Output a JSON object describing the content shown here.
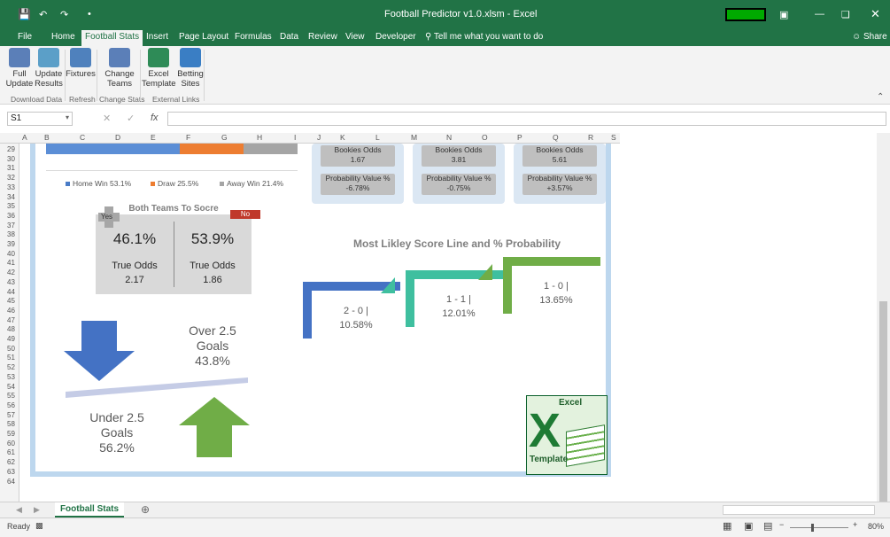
{
  "window": {
    "title": "Football Predictor v1.0.xlsm  -  Excel"
  },
  "ribbon_tabs": [
    "File",
    "Home",
    "Football Stats",
    "Insert",
    "Page Layout",
    "Formulas",
    "Data",
    "Review",
    "View",
    "Developer"
  ],
  "active_tab": "Football Stats",
  "tell_me": "Tell me what you want to do",
  "share": "Share",
  "ribbon": {
    "buttons": [
      {
        "l1": "Full",
        "l2": "Update"
      },
      {
        "l1": "Update",
        "l2": "Results"
      },
      {
        "l1": "Fixtures",
        "l2": ""
      },
      {
        "l1": "Change",
        "l2": "Teams"
      },
      {
        "l1": "Excel",
        "l2": "Template"
      },
      {
        "l1": "Betting",
        "l2": "Sites"
      }
    ],
    "groups": [
      "Download Data",
      "Refresh",
      "Change Stats",
      "External Links"
    ]
  },
  "formula_bar": {
    "name_box": "S1",
    "fx": "fx",
    "formula": ""
  },
  "columns": [
    "A",
    "B",
    "C",
    "D",
    "E",
    "F",
    "G",
    "H",
    "I",
    "J",
    "K",
    "L",
    "M",
    "N",
    "O",
    "P",
    "Q",
    "R",
    "S"
  ],
  "rows": [
    "29",
    "30",
    "31",
    "32",
    "33",
    "34",
    "35",
    "36",
    "37",
    "38",
    "39",
    "40",
    "41",
    "42",
    "43",
    "44",
    "45",
    "46",
    "47",
    "48",
    "49",
    "50",
    "51",
    "52",
    "53",
    "54",
    "55",
    "56",
    "57",
    "58",
    "59",
    "60",
    "61",
    "62",
    "63",
    "64"
  ],
  "legend": [
    {
      "label": "Home Win 53.1%",
      "color": "#4a7cc7"
    },
    {
      "label": "Draw 25.5%",
      "color": "#ed7d31"
    },
    {
      "label": "Away Win 21.4%",
      "color": "#a5a5a5"
    }
  ],
  "outcome_bar": [
    {
      "name": "Home Win",
      "value": 53.1,
      "color": "#5b8ed6"
    },
    {
      "name": "Draw",
      "value": 25.5,
      "color": "#ed7d31"
    },
    {
      "name": "Away Win",
      "value": 21.4,
      "color": "#a5a5a5"
    }
  ],
  "odds_cards": [
    {
      "bookies_label": "Bookies Odds",
      "bookies": "1.67",
      "pv_label": "Probability Value %",
      "pv": "-6.78%"
    },
    {
      "bookies_label": "Bookies Odds",
      "bookies": "3.81",
      "pv_label": "Probability Value %",
      "pv": "-0.75%"
    },
    {
      "bookies_label": "Bookies Odds",
      "bookies": "5.61",
      "pv_label": "Probability Value %",
      "pv": "+3.57%"
    }
  ],
  "btts": {
    "title": "Both Teams To Socre",
    "yes": "Yes",
    "no": "No",
    "yes_pct": "46.1%",
    "no_pct": "53.9%",
    "odds_label": "True Odds",
    "yes_odds": "2.17",
    "no_odds": "1.86"
  },
  "goals": {
    "over_l1": "Over 2.5",
    "over_l2": "Goals",
    "over_pct": "43.8%",
    "under_l1": "Under 2.5",
    "under_l2": "Goals",
    "under_pct": "56.2%"
  },
  "score_title": "Most Likley Score Line and % Probability",
  "chart_data": {
    "type": "bar",
    "title": "Most Likley Score Line and % Probability",
    "categories": [
      "2 - 0",
      "1 - 1",
      "1 - 0"
    ],
    "values": [
      10.58,
      12.01,
      13.65
    ],
    "labels": [
      {
        "l1": "2 - 0 |",
        "l2": "10.58%"
      },
      {
        "l1": "1 - 1 |",
        "l2": "12.01%"
      },
      {
        "l1": "1 - 0 |",
        "l2": "13.65%"
      }
    ],
    "colors": [
      "#4472c4",
      "#3fbf9f",
      "#70ad47"
    ]
  },
  "logo": {
    "top": "Excel",
    "bottom": "Template"
  },
  "sheet_tab": "Football Stats",
  "status": {
    "ready": "Ready",
    "zoom": "80%"
  }
}
